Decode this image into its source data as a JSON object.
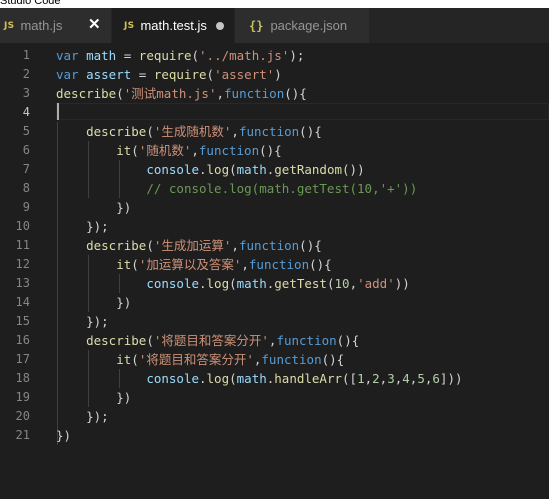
{
  "window": {
    "title": "Studio Code"
  },
  "tabs": [
    {
      "label": "math.js",
      "icon": "js-icon",
      "icon_text": "JS",
      "active": false,
      "close_glyph": "✕"
    },
    {
      "label": "math.test.js",
      "icon": "js-icon",
      "icon_text": "JS",
      "active": true,
      "modified": true
    },
    {
      "label": "package.json",
      "icon": "json-icon",
      "icon_text": "{}",
      "active": false
    }
  ],
  "colors": {
    "background": "#1e1e1e",
    "keyword": "#569cd6",
    "variable": "#9cdcfe",
    "function": "#dcdcaa",
    "string": "#ce9178",
    "number": "#b5cea8",
    "comment": "#6a9955",
    "line_number": "#858585"
  },
  "editor": {
    "current_line": 4,
    "lines": [
      {
        "num": "1",
        "tokens": [
          [
            "kw",
            "var"
          ],
          [
            "pun",
            " "
          ],
          [
            "var",
            "math"
          ],
          [
            "pun",
            " = "
          ],
          [
            "fn",
            "require"
          ],
          [
            "pun",
            "("
          ],
          [
            "str",
            "'../math.js'"
          ],
          [
            "pun",
            ");"
          ]
        ]
      },
      {
        "num": "2",
        "tokens": [
          [
            "kw",
            "var"
          ],
          [
            "pun",
            " "
          ],
          [
            "var",
            "assert"
          ],
          [
            "pun",
            " = "
          ],
          [
            "fn",
            "require"
          ],
          [
            "pun",
            "("
          ],
          [
            "str",
            "'assert'"
          ],
          [
            "pun",
            ")"
          ]
        ]
      },
      {
        "num": "3",
        "tokens": [
          [
            "fn",
            "describe"
          ],
          [
            "pun",
            "("
          ],
          [
            "str",
            "'测试math.js'"
          ],
          [
            "pun",
            ","
          ],
          [
            "kw",
            "function"
          ],
          [
            "pun",
            "(){"
          ]
        ]
      },
      {
        "num": "4",
        "tokens": []
      },
      {
        "num": "5",
        "tokens": [
          [
            "pun",
            "    "
          ],
          [
            "fn",
            "describe"
          ],
          [
            "pun",
            "("
          ],
          [
            "str",
            "'生成随机数'"
          ],
          [
            "pun",
            ","
          ],
          [
            "kw",
            "function"
          ],
          [
            "pun",
            "(){"
          ]
        ]
      },
      {
        "num": "6",
        "tokens": [
          [
            "pun",
            "        "
          ],
          [
            "fn",
            "it"
          ],
          [
            "pun",
            "("
          ],
          [
            "str",
            "'随机数'"
          ],
          [
            "pun",
            ","
          ],
          [
            "kw",
            "function"
          ],
          [
            "pun",
            "(){"
          ]
        ]
      },
      {
        "num": "7",
        "tokens": [
          [
            "pun",
            "            "
          ],
          [
            "var",
            "console"
          ],
          [
            "pun",
            "."
          ],
          [
            "fn",
            "log"
          ],
          [
            "pun",
            "("
          ],
          [
            "var",
            "math"
          ],
          [
            "pun",
            "."
          ],
          [
            "fn",
            "getRandom"
          ],
          [
            "pun",
            "())"
          ]
        ]
      },
      {
        "num": "8",
        "tokens": [
          [
            "pun",
            "            "
          ],
          [
            "com",
            "// console.log(math.getTest(10,'+'))"
          ]
        ]
      },
      {
        "num": "9",
        "tokens": [
          [
            "pun",
            "        })"
          ]
        ]
      },
      {
        "num": "10",
        "tokens": [
          [
            "pun",
            "    });"
          ]
        ]
      },
      {
        "num": "11",
        "tokens": [
          [
            "pun",
            "    "
          ],
          [
            "fn",
            "describe"
          ],
          [
            "pun",
            "("
          ],
          [
            "str",
            "'生成加运算'"
          ],
          [
            "pun",
            ","
          ],
          [
            "kw",
            "function"
          ],
          [
            "pun",
            "(){"
          ]
        ]
      },
      {
        "num": "12",
        "tokens": [
          [
            "pun",
            "        "
          ],
          [
            "fn",
            "it"
          ],
          [
            "pun",
            "("
          ],
          [
            "str",
            "'加运算以及答案'"
          ],
          [
            "pun",
            ","
          ],
          [
            "kw",
            "function"
          ],
          [
            "pun",
            "(){"
          ]
        ]
      },
      {
        "num": "13",
        "tokens": [
          [
            "pun",
            "            "
          ],
          [
            "var",
            "console"
          ],
          [
            "pun",
            "."
          ],
          [
            "fn",
            "log"
          ],
          [
            "pun",
            "("
          ],
          [
            "var",
            "math"
          ],
          [
            "pun",
            "."
          ],
          [
            "fn",
            "getTest"
          ],
          [
            "pun",
            "("
          ],
          [
            "num",
            "10"
          ],
          [
            "pun",
            ","
          ],
          [
            "str",
            "'add'"
          ],
          [
            "pun",
            "))"
          ]
        ]
      },
      {
        "num": "14",
        "tokens": [
          [
            "pun",
            "        })"
          ]
        ]
      },
      {
        "num": "15",
        "tokens": [
          [
            "pun",
            "    });"
          ]
        ]
      },
      {
        "num": "16",
        "tokens": [
          [
            "pun",
            "    "
          ],
          [
            "fn",
            "describe"
          ],
          [
            "pun",
            "("
          ],
          [
            "str",
            "'将题目和答案分开'"
          ],
          [
            "pun",
            ","
          ],
          [
            "kw",
            "function"
          ],
          [
            "pun",
            "(){"
          ]
        ]
      },
      {
        "num": "17",
        "tokens": [
          [
            "pun",
            "        "
          ],
          [
            "fn",
            "it"
          ],
          [
            "pun",
            "("
          ],
          [
            "str",
            "'将题目和答案分开'"
          ],
          [
            "pun",
            ","
          ],
          [
            "kw",
            "function"
          ],
          [
            "pun",
            "(){"
          ]
        ]
      },
      {
        "num": "18",
        "tokens": [
          [
            "pun",
            "            "
          ],
          [
            "var",
            "console"
          ],
          [
            "pun",
            "."
          ],
          [
            "fn",
            "log"
          ],
          [
            "pun",
            "("
          ],
          [
            "var",
            "math"
          ],
          [
            "pun",
            "."
          ],
          [
            "fn",
            "handleArr"
          ],
          [
            "pun",
            "(["
          ],
          [
            "num",
            "1"
          ],
          [
            "pun",
            ","
          ],
          [
            "num",
            "2"
          ],
          [
            "pun",
            ","
          ],
          [
            "num",
            "3"
          ],
          [
            "pun",
            ","
          ],
          [
            "num",
            "4"
          ],
          [
            "pun",
            ","
          ],
          [
            "num",
            "5"
          ],
          [
            "pun",
            ","
          ],
          [
            "num",
            "6"
          ],
          [
            "pun",
            "]))"
          ]
        ]
      },
      {
        "num": "19",
        "tokens": [
          [
            "pun",
            "        })"
          ]
        ]
      },
      {
        "num": "20",
        "tokens": [
          [
            "pun",
            "    });"
          ]
        ]
      },
      {
        "num": "21",
        "tokens": [
          [
            "pun",
            "})"
          ]
        ]
      }
    ]
  }
}
